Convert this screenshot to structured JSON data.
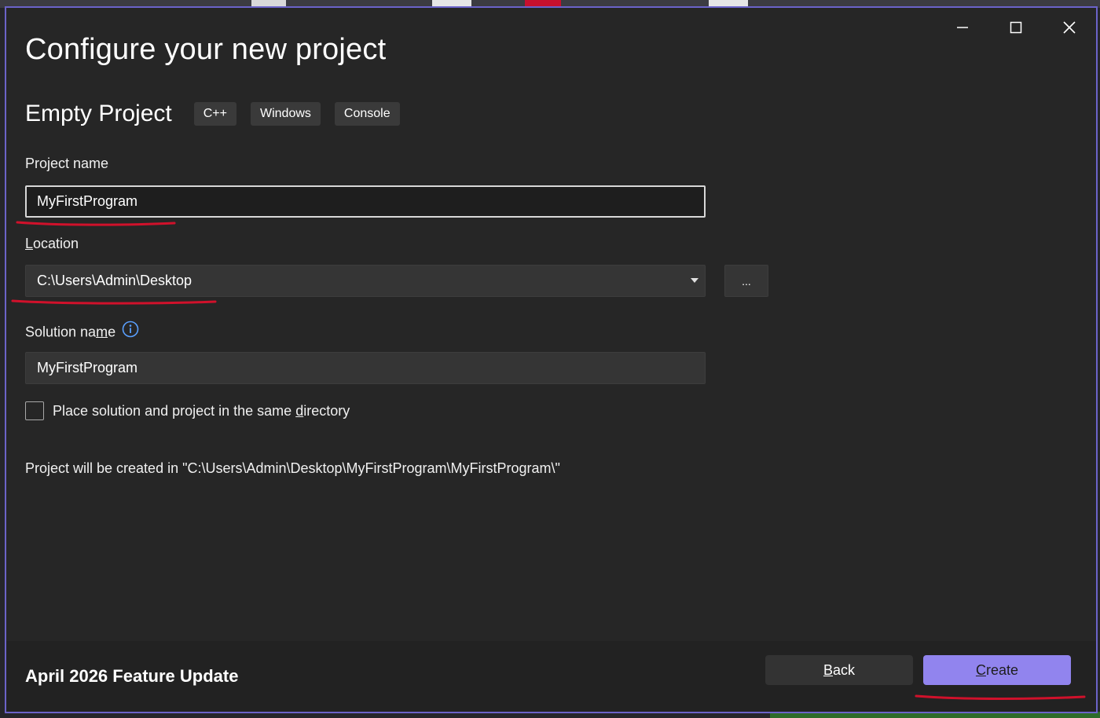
{
  "window": {
    "title": "Configure your new project",
    "controls": {
      "minimize": "minimize-icon",
      "maximize": "maximize-icon",
      "close": "close-icon"
    }
  },
  "template": {
    "name": "Empty Project",
    "tags": [
      "C++",
      "Windows",
      "Console"
    ]
  },
  "form": {
    "project_name": {
      "label": "Project name",
      "value": "MyFirstProgram"
    },
    "location": {
      "label_accel": "L",
      "label_rest": "ocation",
      "value": "C:\\Users\\Admin\\Desktop",
      "browse_label": "..."
    },
    "solution_name": {
      "label_pre": "Solution na",
      "label_accel": "m",
      "label_post": "e",
      "value": "MyFirstProgram",
      "info_icon": "info-icon"
    },
    "same_directory": {
      "label_pre": "Place solution and project in the same ",
      "label_accel": "d",
      "label_post": "irectory",
      "checked": false
    },
    "path_info": "Project will be created in \"C:\\Users\\Admin\\Desktop\\MyFirstProgram\\MyFirstProgram\\\""
  },
  "footer": {
    "update_text": "April 2026 Feature Update",
    "back_accel": "B",
    "back_rest": "ack",
    "create_accel": "C",
    "create_rest": "reate"
  },
  "colors": {
    "accent": "#9184ee",
    "dialog_border": "#6b63c9",
    "annotation_red": "#d0112b"
  }
}
